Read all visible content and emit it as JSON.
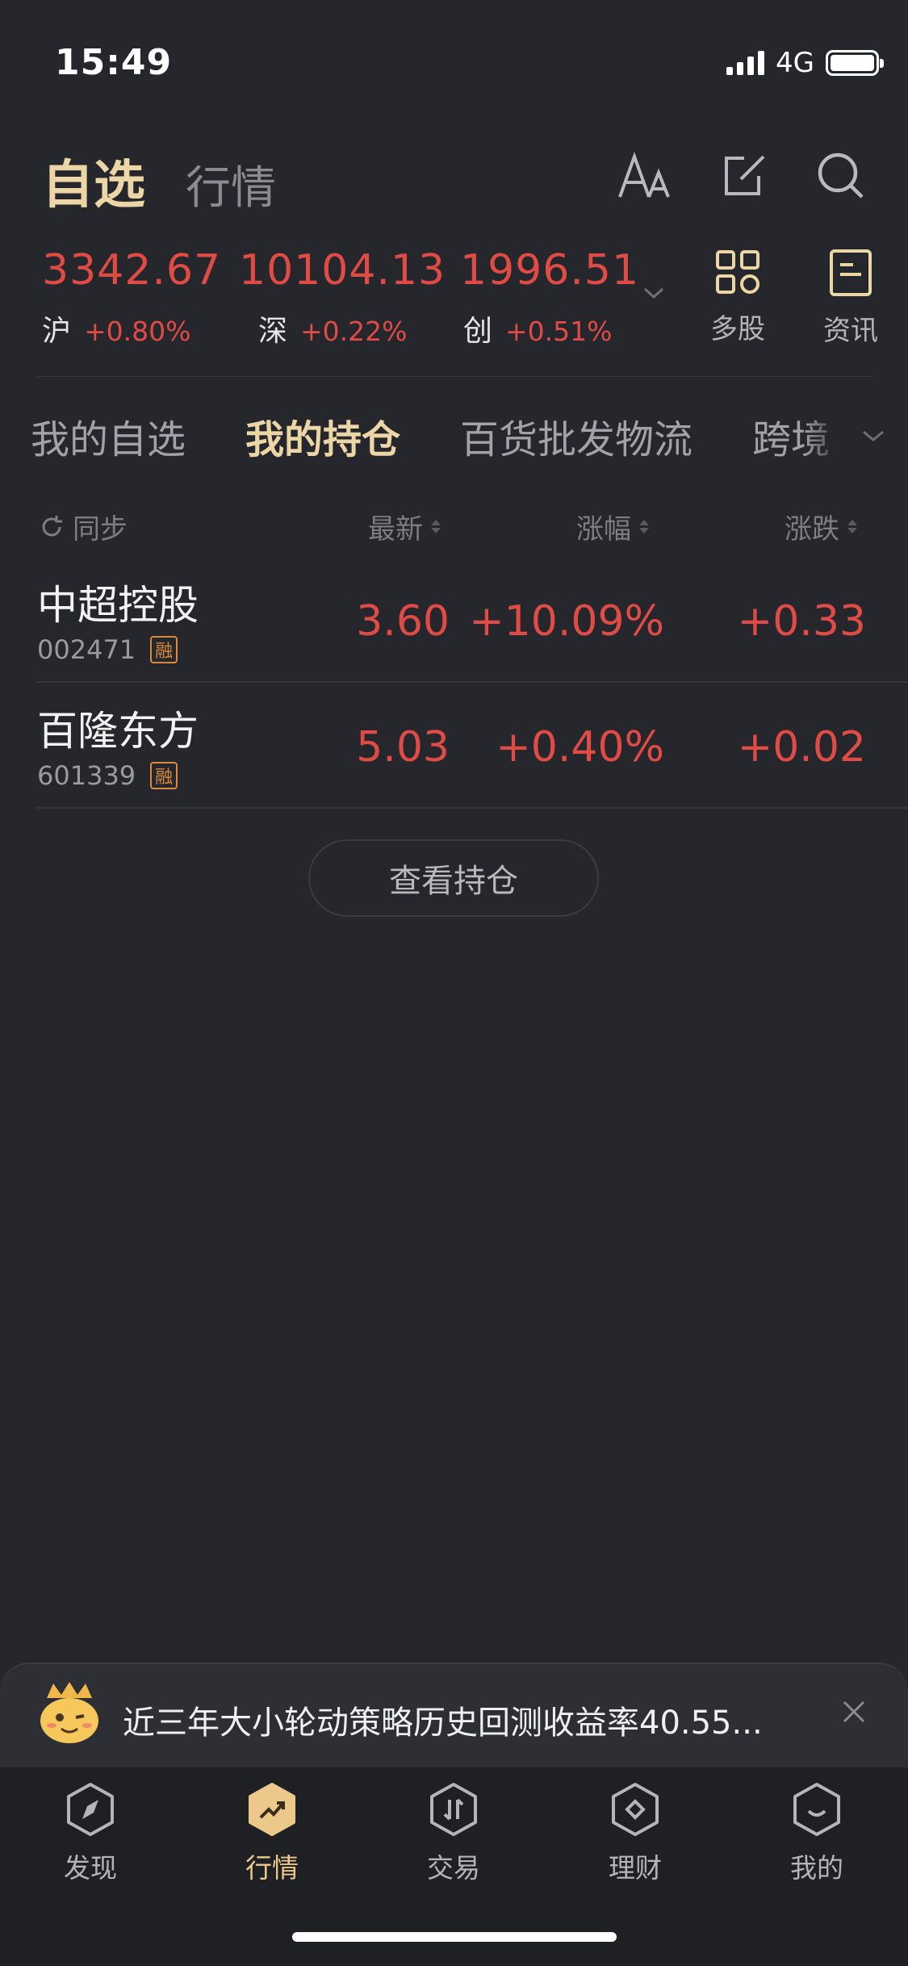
{
  "status": {
    "time": "15:49",
    "network": "4G"
  },
  "header": {
    "tab_active": "自选",
    "tab_other": "行情"
  },
  "indices": [
    {
      "value": "3342.67",
      "name": "沪",
      "change": "+0.80%"
    },
    {
      "value": "10104.13",
      "name": "深",
      "change": "+0.22%"
    },
    {
      "value": "1996.51",
      "name": "创",
      "change": "+0.51%"
    }
  ],
  "quick": {
    "multi": "多股",
    "news": "资讯"
  },
  "subtabs": [
    "我的自选",
    "我的持仓",
    "百货批发物流",
    "跨境"
  ],
  "table": {
    "sync": "同步",
    "col_latest": "最新",
    "col_pct": "涨幅",
    "col_change": "涨跌",
    "rows": [
      {
        "name": "中超控股",
        "code": "002471",
        "badge": "融",
        "latest": "3.60",
        "pct": "+10.09%",
        "change": "+0.33"
      },
      {
        "name": "百隆东方",
        "code": "601339",
        "badge": "融",
        "latest": "5.03",
        "pct": "+0.40%",
        "change": "+0.02"
      }
    ]
  },
  "view_button": "查看持仓",
  "banner": {
    "text": "近三年大小轮动策略历史回测收益率40.55..."
  },
  "nav": {
    "discover": "发现",
    "market": "行情",
    "trade": "交易",
    "finance": "理财",
    "mine": "我的"
  },
  "colors": {
    "accent": "#ecd6a6",
    "up": "#e14b45",
    "bg": "#25272c"
  }
}
